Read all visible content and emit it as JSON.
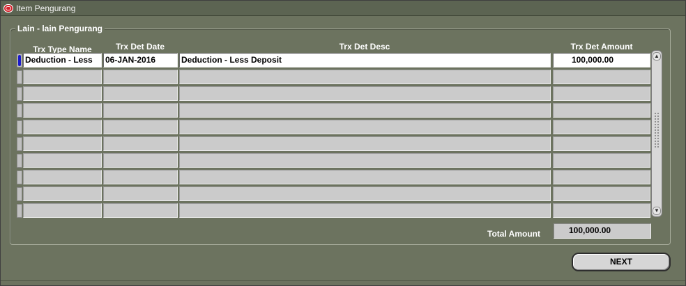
{
  "window": {
    "title": "Item Pengurang"
  },
  "group": {
    "title": "Lain - lain Pengurang"
  },
  "columns": {
    "type_name": "Trx Type Name",
    "det_date": "Trx Det Date",
    "det_desc": "Trx Det Desc",
    "det_amount": "Trx Det Amount"
  },
  "rows": [
    {
      "type_name": "Deduction - Less",
      "det_date": "06-JAN-2016",
      "det_desc": "Deduction - Less Deposit",
      "det_amount": "100,000.00"
    },
    {
      "type_name": "",
      "det_date": "",
      "det_desc": "",
      "det_amount": ""
    },
    {
      "type_name": "",
      "det_date": "",
      "det_desc": "",
      "det_amount": ""
    },
    {
      "type_name": "",
      "det_date": "",
      "det_desc": "",
      "det_amount": ""
    },
    {
      "type_name": "",
      "det_date": "",
      "det_desc": "",
      "det_amount": ""
    },
    {
      "type_name": "",
      "det_date": "",
      "det_desc": "",
      "det_amount": ""
    },
    {
      "type_name": "",
      "det_date": "",
      "det_desc": "",
      "det_amount": ""
    },
    {
      "type_name": "",
      "det_date": "",
      "det_desc": "",
      "det_amount": ""
    },
    {
      "type_name": "",
      "det_date": "",
      "det_desc": "",
      "det_amount": ""
    },
    {
      "type_name": "",
      "det_date": "",
      "det_desc": "",
      "det_amount": ""
    }
  ],
  "total": {
    "label": "Total Amount",
    "value": "100,000.00"
  },
  "buttons": {
    "next": "NEXT"
  },
  "icons": {
    "window_icon": "oracle-icon",
    "scroll_up": "arrow-up-icon",
    "scroll_down": "arrow-down-icon"
  },
  "colors": {
    "background": "#6c735f",
    "field": "#cbcbcb",
    "active_field": "#ffffff",
    "record_indicator": "#1a1acc"
  }
}
